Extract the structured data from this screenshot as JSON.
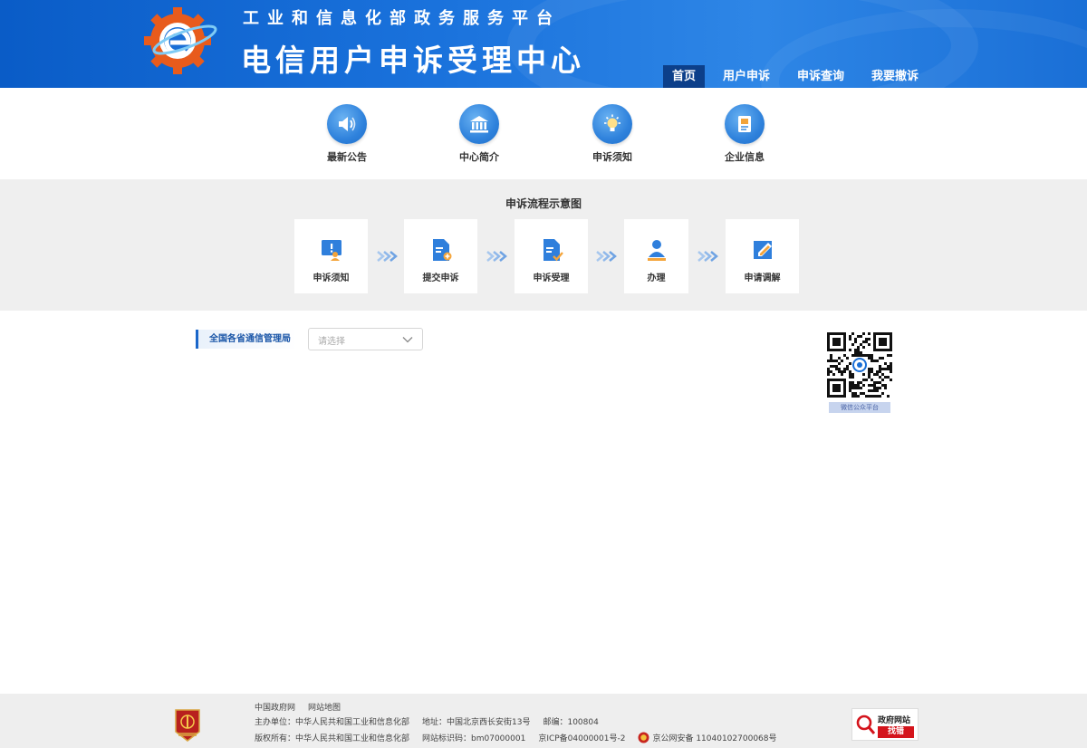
{
  "header": {
    "subtitle": "工业和信息化部政务服务平台",
    "title": "电信用户申诉受理中心",
    "nav": [
      {
        "label": "首页"
      },
      {
        "label": "用户申诉"
      },
      {
        "label": "申诉查询"
      },
      {
        "label": "我要撤诉"
      }
    ]
  },
  "quick_links": [
    {
      "label": "最新公告",
      "icon": "speaker-icon"
    },
    {
      "label": "中心简介",
      "icon": "building-icon"
    },
    {
      "label": "申诉须知",
      "icon": "lightbulb-icon"
    },
    {
      "label": "企业信息",
      "icon": "document-icon"
    }
  ],
  "flow": {
    "title": "申诉流程示意图",
    "steps": [
      {
        "label": "申诉须知",
        "icon": "notice-icon"
      },
      {
        "label": "提交申诉",
        "icon": "submit-document-icon"
      },
      {
        "label": "申诉受理",
        "icon": "accepted-document-icon"
      },
      {
        "label": "办理",
        "icon": "handler-person-icon"
      },
      {
        "label": "申请调解",
        "icon": "edit-pen-icon"
      }
    ]
  },
  "province": {
    "label": "全国各省通信管理局",
    "placeholder": "请选择"
  },
  "qr": {
    "caption": "微信公众平台"
  },
  "footer": {
    "links": [
      "中国政府网",
      "网站地图"
    ],
    "sponsor": "主办单位：中华人民共和国工业和信息化部",
    "address": "地址：中国北京西长安街13号",
    "postcode": "邮编：100804",
    "copyright": "版权所有：中华人民共和国工业和信息化部",
    "site_code": "网站标识码：bm07000001",
    "icp": "京ICP备04000001号-2",
    "police": "京公网安备 11040102700068号",
    "badge_title": "政府网站",
    "badge_action": "找错"
  },
  "colors": {
    "header_blue": "#1a72dc",
    "nav_active": "#0c3f8a",
    "accent_blue": "#1a66c9",
    "flow_bg": "#efefef",
    "badge_red": "#d4141c"
  }
}
